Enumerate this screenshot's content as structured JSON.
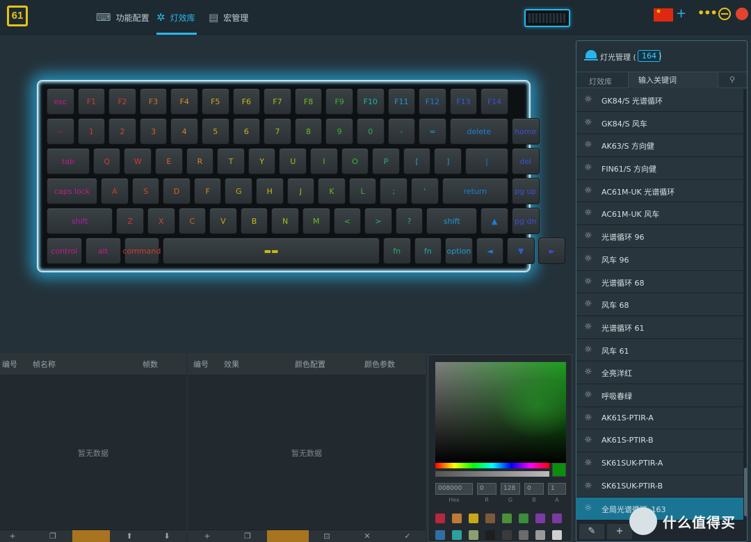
{
  "app": {
    "logo_text": "61",
    "tabs": [
      {
        "label": "功能配置",
        "icon": "keyboard-icon"
      },
      {
        "label": "灯效库",
        "icon": "gear-icon",
        "active": true
      },
      {
        "label": "宏管理",
        "icon": "document-icon"
      }
    ]
  },
  "header": {
    "add": "+",
    "more": "•••"
  },
  "keyboard": {
    "rows": [
      [
        {
          "t": "esc",
          "c": "#c21d88"
        },
        {
          "t": "F1",
          "c": "#d13b2e"
        },
        {
          "t": "F2",
          "c": "#d13b2e"
        },
        {
          "t": "F3",
          "c": "#d96a1f"
        },
        {
          "t": "F4",
          "c": "#d8901d"
        },
        {
          "t": "F5",
          "c": "#c9a617"
        },
        {
          "t": "F6",
          "c": "#c9b817"
        },
        {
          "t": "F7",
          "c": "#a6be17"
        },
        {
          "t": "F8",
          "c": "#6ebc1c"
        },
        {
          "t": "F9",
          "c": "#3ab52c"
        },
        {
          "t": "F10",
          "c": "#20b0a6"
        },
        {
          "t": "F11",
          "c": "#1c9ad6"
        },
        {
          "t": "F12",
          "c": "#1c7fd6"
        },
        {
          "t": "F13",
          "c": "#2a5fd6"
        },
        {
          "t": "F14",
          "c": "#3b4fd6"
        }
      ],
      [
        {
          "t": "~",
          "c": "#c21d4a"
        },
        {
          "t": "1",
          "c": "#d13b2e"
        },
        {
          "t": "2",
          "c": "#d14a2e"
        },
        {
          "t": "3",
          "c": "#d9631f"
        },
        {
          "t": "4",
          "c": "#d8841d"
        },
        {
          "t": "5",
          "c": "#c9a617"
        },
        {
          "t": "6",
          "c": "#c9b817"
        },
        {
          "t": "7",
          "c": "#a6be17"
        },
        {
          "t": "8",
          "c": "#6ebc1c"
        },
        {
          "t": "9",
          "c": "#3ab52c"
        },
        {
          "t": "0",
          "c": "#28b06a"
        },
        {
          "t": "-",
          "c": "#20b0a6"
        },
        {
          "t": "=",
          "c": "#1c9ad6"
        },
        {
          "t": "delete",
          "c": "#1c7fd6"
        },
        {
          "t": "home",
          "c": "#3b4fd6"
        }
      ],
      [
        {
          "t": "tab",
          "c": "#c21d88"
        },
        {
          "t": "Q",
          "c": "#d13b2e"
        },
        {
          "t": "W",
          "c": "#d13b2e"
        },
        {
          "t": "E",
          "c": "#d9631f"
        },
        {
          "t": "R",
          "c": "#d8841d"
        },
        {
          "t": "T",
          "c": "#c9a617"
        },
        {
          "t": "Y",
          "c": "#c9b817"
        },
        {
          "t": "U",
          "c": "#a6be17"
        },
        {
          "t": "I",
          "c": "#6ebc1c"
        },
        {
          "t": "O",
          "c": "#3ab52c"
        },
        {
          "t": "P",
          "c": "#28b06a"
        },
        {
          "t": "[",
          "c": "#20a0c6"
        },
        {
          "t": "]",
          "c": "#1c9ad6"
        },
        {
          "t": "|",
          "c": "#1c7fd6"
        },
        {
          "t": "del",
          "c": "#3b4fd6"
        }
      ],
      [
        {
          "t": "caps lock",
          "c": "#c21d88"
        },
        {
          "t": "A",
          "c": "#d13b2e"
        },
        {
          "t": "S",
          "c": "#d14a2e"
        },
        {
          "t": "D",
          "c": "#d9631f"
        },
        {
          "t": "F",
          "c": "#d8841d"
        },
        {
          "t": "G",
          "c": "#c9a617"
        },
        {
          "t": "H",
          "c": "#c9b817"
        },
        {
          "t": "J",
          "c": "#a6be17"
        },
        {
          "t": "K",
          "c": "#6ebc1c"
        },
        {
          "t": "L",
          "c": "#3ab52c"
        },
        {
          "t": ";",
          "c": "#28b06a"
        },
        {
          "t": "'",
          "c": "#20b0a6"
        },
        {
          "t": "return",
          "c": "#1c7fd6"
        },
        {
          "t": "pg up",
          "c": "#3b4fd6"
        }
      ],
      [
        {
          "t": "shift",
          "c": "#b01da8"
        },
        {
          "t": "Z",
          "c": "#d13b2e"
        },
        {
          "t": "X",
          "c": "#d14a2e"
        },
        {
          "t": "C",
          "c": "#d9631f"
        },
        {
          "t": "V",
          "c": "#c9a617"
        },
        {
          "t": "B",
          "c": "#c9b817"
        },
        {
          "t": "N",
          "c": "#a6be17"
        },
        {
          "t": "M",
          "c": "#6ebc1c"
        },
        {
          "t": "<",
          "c": "#3ab52c"
        },
        {
          "t": ">",
          "c": "#28b06a"
        },
        {
          "t": "?",
          "c": "#28b06a"
        },
        {
          "t": "shift",
          "c": "#1c9ad6"
        },
        {
          "t": "▲",
          "c": "#1c7fd6"
        },
        {
          "t": "pg dn",
          "c": "#3b4fd6"
        }
      ],
      [
        {
          "t": "control",
          "c": "#c21d88"
        },
        {
          "t": "alt",
          "c": "#c21d88"
        },
        {
          "t": "command",
          "c": "#d13b2e"
        },
        {
          "t": "▬▬",
          "c": "#c9b817"
        },
        {
          "t": "fn",
          "c": "#28b06a"
        },
        {
          "t": "fn",
          "c": "#20b0a6"
        },
        {
          "t": "option",
          "c": "#1c9ad6"
        },
        {
          "t": "◄",
          "c": "#1c7fd6"
        },
        {
          "t": "▼",
          "c": "#2a5fd6"
        },
        {
          "t": "►",
          "c": "#3b4fd6"
        }
      ]
    ]
  },
  "frames_panel": {
    "col_num": "编号",
    "col_name": "帧名称",
    "col_frames": "帧数",
    "empty": "暂无数据"
  },
  "effects_panel": {
    "col_num": "编号",
    "col_effect": "效果",
    "col_color": "颜色配置",
    "col_param": "颜色参数",
    "empty": "暂无数据"
  },
  "color_picker": {
    "hex": "008000",
    "r": "0",
    "g": "128",
    "b": "0",
    "a": "1",
    "labels": {
      "hex": "Hex",
      "r": "R",
      "g": "G",
      "b": "B",
      "a": "A"
    },
    "swatches": [
      "#b5283e",
      "#c07a35",
      "#c9a817",
      "#7b5a3a",
      "#4c8f3b",
      "#3b8c3b",
      "#7b3aa5",
      "#7b3a9f",
      "#2f6fa5",
      "#2fa0a0",
      "#8aa06f",
      "#1e1e1e",
      "#3a3a3a",
      "#6b6b6b",
      "#9a9a9a",
      "#cfcfcf"
    ]
  },
  "sidebar": {
    "title": "灯光管理 (",
    "count": "164",
    "paren": ")",
    "filter_label": "灯效库",
    "search_placeholder": "输入关键词",
    "items": [
      "GK84/S 光谱循环",
      "GK84/S 风车",
      "AK63/S 方向健",
      "FIN61/S 方向健",
      "AC61M-UK 光谱循环",
      "AC61M-UK 风车",
      "光谱循环 96",
      "风车 96",
      "光谱循环 68",
      "风车 68",
      "光谱循环 61",
      "风车 61",
      "全亮洋红",
      "呼吸春绿",
      "AK61S-PTIR-A",
      "AK61S-PTIR-B",
      "SK61SUK-PTIR-A",
      "SK61SUK-PTIR-B",
      "全局光谱循环_163"
    ],
    "selected_index": 18
  },
  "watermark": {
    "text": "什么值得买"
  }
}
